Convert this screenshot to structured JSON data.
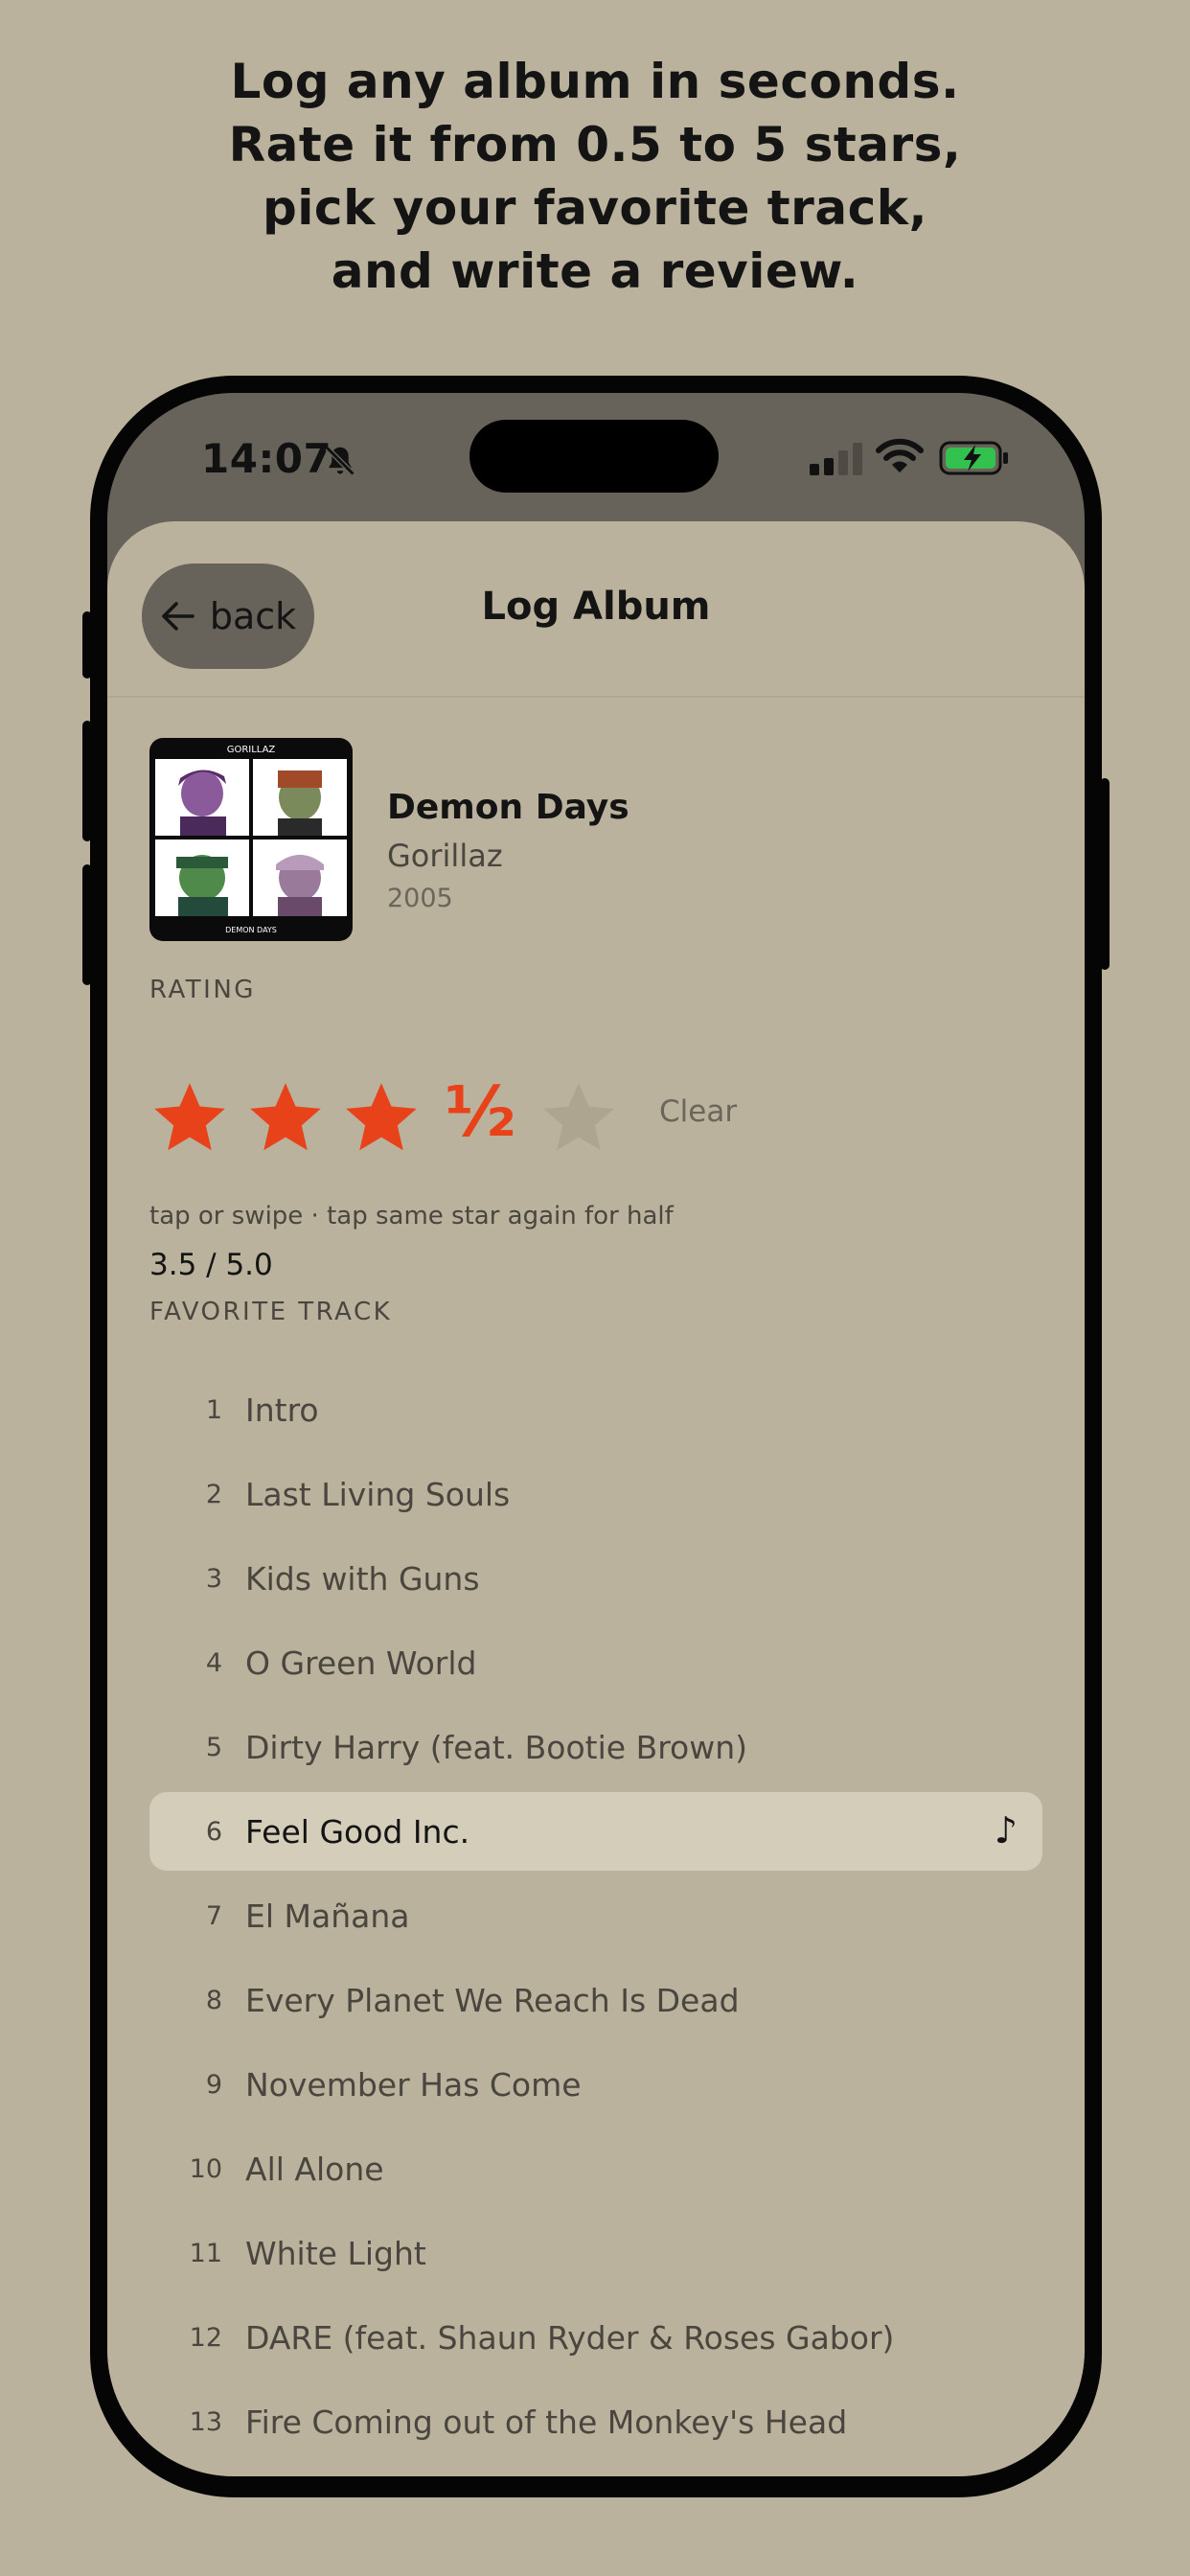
{
  "headline": [
    "Log any album in seconds.",
    "Rate it from 0.5 to 5 stars,",
    "pick your favorite track,",
    "and write a review."
  ],
  "status_bar": {
    "time": "14:07"
  },
  "nav": {
    "back_label": "back",
    "title": "Log Album"
  },
  "album": {
    "title": "Demon Days",
    "artist": "Gorillaz",
    "year": "2005",
    "cover_top_text": "GORILLAZ",
    "cover_bottom_text": "DEMON DAYS"
  },
  "rating": {
    "section_label": "RATING",
    "value": 3.5,
    "max": 5,
    "half_glyph": "½",
    "clear_label": "Clear",
    "hint": "tap or swipe · tap same star again for half",
    "score_text": "3.5 / 5.0"
  },
  "favorite_track": {
    "section_label": "FAVORITE TRACK",
    "selected_index": 6,
    "selected_icon": "♪",
    "tracks": [
      {
        "num": "1",
        "name": "Intro"
      },
      {
        "num": "2",
        "name": "Last Living Souls"
      },
      {
        "num": "3",
        "name": "Kids with Guns"
      },
      {
        "num": "4",
        "name": "O Green World"
      },
      {
        "num": "5",
        "name": "Dirty Harry (feat. Bootie Brown)"
      },
      {
        "num": "6",
        "name": "Feel Good Inc."
      },
      {
        "num": "7",
        "name": "El Mañana"
      },
      {
        "num": "8",
        "name": "Every Planet We Reach Is Dead"
      },
      {
        "num": "9",
        "name": "November Has Come"
      },
      {
        "num": "10",
        "name": "All Alone"
      },
      {
        "num": "11",
        "name": "White Light"
      },
      {
        "num": "12",
        "name": "DARE (feat. Shaun Ryder & Roses Gabor)"
      },
      {
        "num": "13",
        "name": "Fire Coming out of the Monkey's Head"
      }
    ]
  },
  "colors": {
    "background": "#bab29c",
    "accent": "#e8421b",
    "selected_row": "#d4cdb9",
    "empty_star": "#ada590"
  },
  "icons": {
    "bell": "bell-slash-icon",
    "signal": "cellular-signal-icon",
    "wifi": "wifi-icon",
    "battery": "battery-charging-icon",
    "back": "arrow-left-icon",
    "star": "star-icon",
    "note": "music-note-icon"
  }
}
